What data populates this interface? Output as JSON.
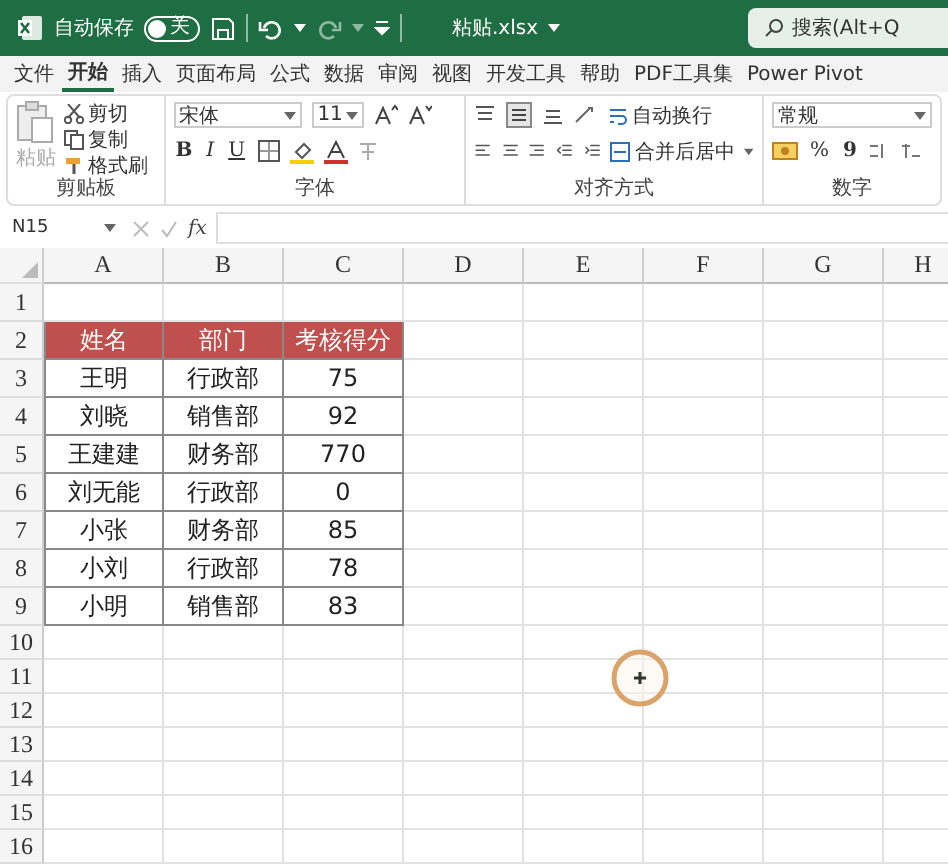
{
  "title_bar": {
    "autosave_label": "自动保存",
    "autosave_toggle": {
      "on": false,
      "label": "关"
    },
    "filename": "粘贴.xlsx",
    "search": {
      "placeholder": "搜索(Alt+Q"
    }
  },
  "tabs": [
    {
      "label": "文件",
      "selected": false
    },
    {
      "label": "开始",
      "selected": true
    },
    {
      "label": "插入",
      "selected": false
    },
    {
      "label": "页面布局",
      "selected": false
    },
    {
      "label": "公式",
      "selected": false
    },
    {
      "label": "数据",
      "selected": false
    },
    {
      "label": "审阅",
      "selected": false
    },
    {
      "label": "视图",
      "selected": false
    },
    {
      "label": "开发工具",
      "selected": false
    },
    {
      "label": "帮助",
      "selected": false
    },
    {
      "label": "PDF工具集",
      "selected": false
    },
    {
      "label": "Power Pivot",
      "selected": false
    }
  ],
  "ribbon": {
    "clipboard": {
      "paste": "粘贴",
      "cut": "剪切",
      "copy": "复制",
      "format_painter": "格式刷",
      "label": "剪贴板"
    },
    "font": {
      "font_name": "宋体",
      "font_size": "11",
      "bold": "B",
      "italic": "I",
      "underline": "U",
      "label": "字体"
    },
    "alignment": {
      "wrap_text": "自动换行",
      "merge_center": "合并后居中",
      "label": "对齐方式"
    },
    "number": {
      "format": "常规",
      "percent": "%",
      "comma": "9",
      "label": "数字"
    }
  },
  "formula_bar": {
    "name_box": "N15",
    "fx": "fx"
  },
  "columns": [
    "A",
    "B",
    "C",
    "D",
    "E",
    "F",
    "G",
    "H"
  ],
  "rows": [
    {
      "number": "1"
    },
    {
      "number": "2",
      "kind": "header",
      "cells": [
        "姓名",
        "部门",
        "考核得分"
      ]
    },
    {
      "number": "3",
      "kind": "data",
      "cells": [
        "王明",
        "行政部",
        "75"
      ]
    },
    {
      "number": "4",
      "kind": "data",
      "cells": [
        "刘晓",
        "销售部",
        "92"
      ]
    },
    {
      "number": "5",
      "kind": "data",
      "cells": [
        "王建建",
        "财务部",
        "770"
      ]
    },
    {
      "number": "6",
      "kind": "data",
      "cells": [
        "刘无能",
        "行政部",
        "0"
      ]
    },
    {
      "number": "7",
      "kind": "data",
      "cells": [
        "小张",
        "财务部",
        "85"
      ]
    },
    {
      "number": "8",
      "kind": "data",
      "cells": [
        "小刘",
        "行政部",
        "78"
      ]
    },
    {
      "number": "9",
      "kind": "data",
      "cells": [
        "小明",
        "销售部",
        "83"
      ]
    },
    {
      "number": "10"
    },
    {
      "number": "11"
    },
    {
      "number": "12"
    },
    {
      "number": "13"
    },
    {
      "number": "14"
    },
    {
      "number": "15"
    },
    {
      "number": "16"
    }
  ]
}
